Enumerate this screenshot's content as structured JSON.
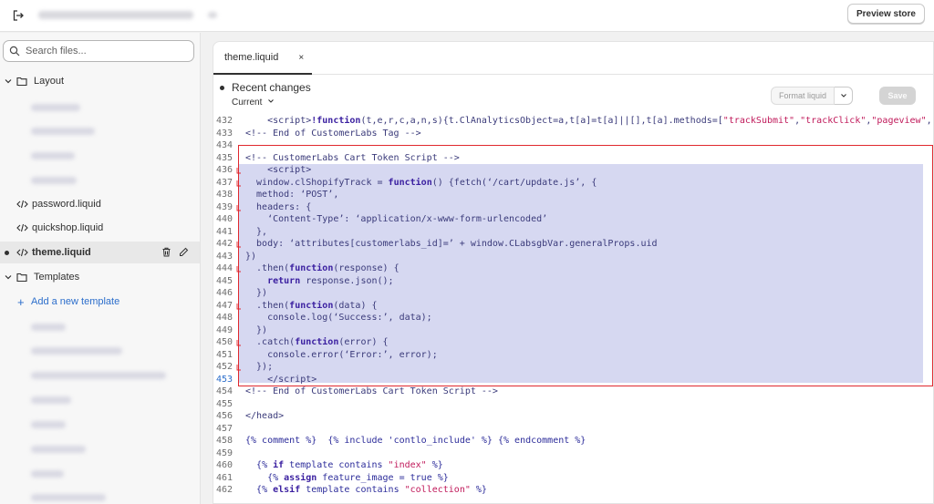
{
  "topbar": {
    "preview_label": "Preview store"
  },
  "sidebar": {
    "search_placeholder": "Search files...",
    "layout_folder": "Layout",
    "files": [
      {
        "label": "password.liquid"
      },
      {
        "label": "quickshop.liquid"
      },
      {
        "label": "theme.liquid"
      }
    ],
    "templates_folder": "Templates",
    "add_template": "Add a new template"
  },
  "editor": {
    "tab_label": "theme.liquid",
    "tab_close": "×",
    "recent_changes": "Recent changes",
    "current": "Current",
    "format_label": "Format liquid",
    "save_label": "Save",
    "lines": [
      {
        "n": "432",
        "html": "    &lt;script&gt;<span class=\"tk-kw\">!function</span>(t,e,r,c,a,n,s){t.ClAnalyticsObject=a,t[a]=t[a]||[],t[a].methods=[<span class=\"tk-str\">\"trackSubmit\"</span>,<span class=\"tk-str\">\"trackClick\"</span>,<span class=\"tk-str\">\"pageview\"</span>,<span class=\"tk-str\">\"id</span>"
      },
      {
        "n": "433",
        "html": "<span class=\"tk-cm\">&lt;!-- End of CustomerLabs Tag --&gt;</span>"
      },
      {
        "n": "434",
        "html": ""
      },
      {
        "n": "435",
        "html": "<span class=\"tk-cm\">&lt;!-- CustomerLabs Cart Token Script --&gt;</span>"
      },
      {
        "n": "436",
        "html": "    &lt;script&gt;"
      },
      {
        "n": "437",
        "html": "  window.clShopifyTrack = <span class=\"tk-kw\">function</span>() {fetch(‘/cart/update.js’, {"
      },
      {
        "n": "438",
        "html": "  method: ‘POST’,"
      },
      {
        "n": "439",
        "html": "  headers: {"
      },
      {
        "n": "440",
        "html": "    ‘Content-Type’: ‘application/x-www-form-urlencoded’"
      },
      {
        "n": "441",
        "html": "  },"
      },
      {
        "n": "442",
        "html": "  body: ‘attributes[customerlabs_id]=’ + window.CLabsgbVar.generalProps.uid"
      },
      {
        "n": "443",
        "html": "})"
      },
      {
        "n": "444",
        "html": "  .then(<span class=\"tk-kw\">function</span>(response) {"
      },
      {
        "n": "445",
        "html": "    <span class=\"tk-kw\">return</span> response.json();"
      },
      {
        "n": "446",
        "html": "  })"
      },
      {
        "n": "447",
        "html": "  .then(<span class=\"tk-kw\">function</span>(data) {"
      },
      {
        "n": "448",
        "html": "    console.log(‘Success:’, data);"
      },
      {
        "n": "449",
        "html": "  })"
      },
      {
        "n": "450",
        "html": "  .catch(<span class=\"tk-kw\">function</span>(error) {"
      },
      {
        "n": "451",
        "html": "    console.error(‘Error:’, error);"
      },
      {
        "n": "452",
        "html": "  });"
      },
      {
        "n": "453",
        "html": "    &lt;/script&gt;"
      },
      {
        "n": "454",
        "html": "<span class=\"tk-cm\">&lt;!-- End of CustomerLabs Cart Token Script --&gt;</span>"
      },
      {
        "n": "455",
        "html": ""
      },
      {
        "n": "456",
        "html": "&lt;/head&gt;"
      },
      {
        "n": "457",
        "html": ""
      },
      {
        "n": "458",
        "html": "<span class=\"tk-lq\">{% comment %}</span>  <span class=\"tk-lq\">{% include 'contlo_include' %}</span> <span class=\"tk-lq\">{% endcomment %}</span>"
      },
      {
        "n": "459",
        "html": ""
      },
      {
        "n": "460",
        "html": "  <span class=\"tk-lq\">{% <span class=\"tk-kw\">if</span> template contains <span class=\"tk-str\">\"index\"</span> %}</span>"
      },
      {
        "n": "461",
        "html": "    <span class=\"tk-lq\">{% <span class=\"tk-kw\">assign</span> feature_image = true %}</span>"
      },
      {
        "n": "462",
        "html": "  <span class=\"tk-lq\">{% <span class=\"tk-kw\">elsif</span> template contains <span class=\"tk-str\">\"collection\"</span> %}</span>"
      }
    ]
  }
}
